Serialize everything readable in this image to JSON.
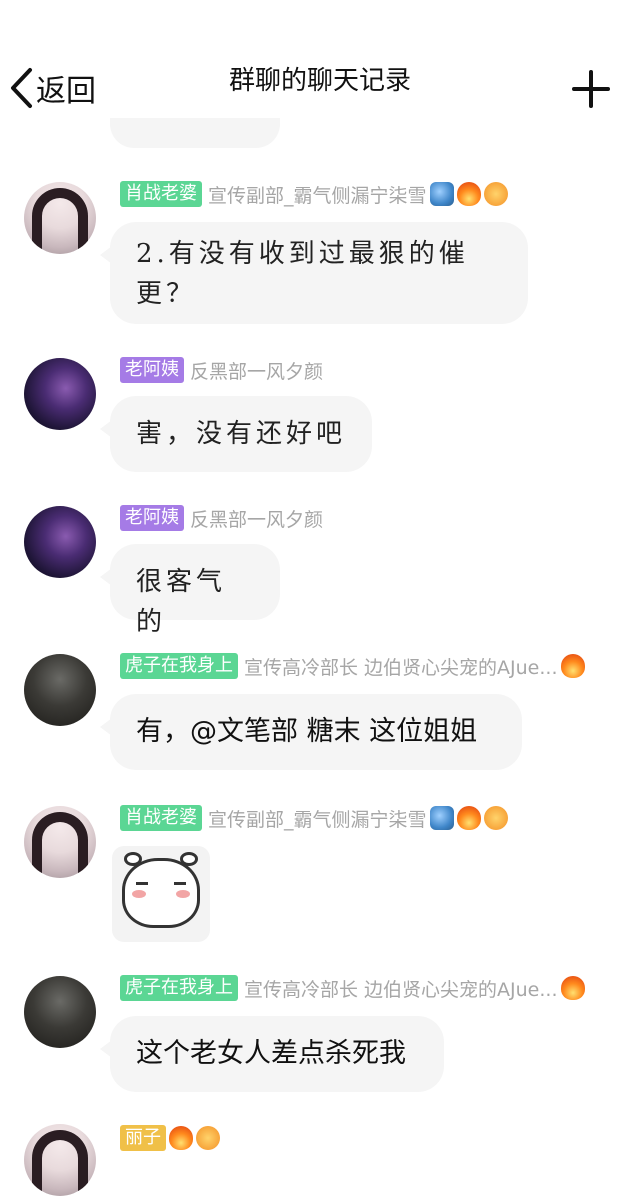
{
  "header": {
    "back_label": "返回",
    "title": "群聊的聊天记录"
  },
  "messages": [
    {
      "badge": "肖战老婆",
      "badge_color": "#5bd694",
      "subtitle": "宣传副部_霸气侧漏宁柒雪",
      "emojis": [
        "dragon-icon",
        "fire-icon",
        "smile-icon"
      ],
      "lines": [
        "2.有没有收到过最狠的催",
        "更？"
      ]
    },
    {
      "badge": "老阿姨",
      "badge_color": "#a57be6",
      "subtitle": "反黑部一风夕颜",
      "lines": [
        "害，没有还好吧"
      ]
    },
    {
      "badge": "老阿姨",
      "badge_color": "#a57be6",
      "subtitle": "反黑部一风夕颜",
      "lines": [
        "很客气的"
      ]
    },
    {
      "badge": "虎子在我身上",
      "badge_color": "#5bd694",
      "subtitle": "宣传高冷部长  边伯贤心尖宠的AJue...",
      "emojis": [
        "fire-icon"
      ],
      "lines": [
        "有，@文笔部  糖末 这位姐姐"
      ]
    },
    {
      "badge": "肖战老婆",
      "badge_color": "#5bd694",
      "subtitle": "宣传副部_霸气侧漏宁柒雪",
      "emojis": [
        "dragon-icon",
        "fire-icon",
        "smile-icon"
      ],
      "sticker": "bear-sticker"
    },
    {
      "badge": "虎子在我身上",
      "badge_color": "#5bd694",
      "subtitle": "宣传高冷部长  边伯贤心尖宠的AJue...",
      "emojis": [
        "fire-icon"
      ],
      "lines": [
        "这个老女人差点杀死我"
      ]
    },
    {
      "badge": "丽子",
      "badge_color": "#f0c048",
      "emojis": [
        "fire-icon",
        "smile-icon"
      ]
    }
  ]
}
